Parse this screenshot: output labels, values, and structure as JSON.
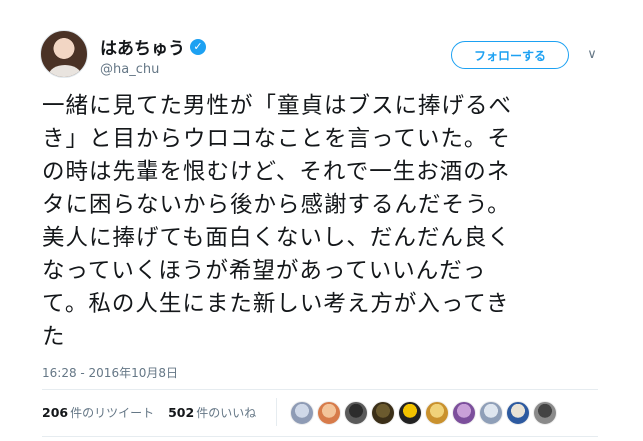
{
  "user": {
    "display_name": "はあちゅう",
    "screen_name": "@ha_chu",
    "verified_icon": "verified-badge-icon"
  },
  "follow_button": {
    "label": "フォローする"
  },
  "caret": {
    "icon": "chevron-down-icon",
    "glyph": "∨"
  },
  "tweet": {
    "lines": [
      "一緒に見てた男性が「童貞はブスに捧げるべ",
      "き」と目からウロコなことを言っていた。そ",
      "の時は先輩を恨むけど、それで一生お酒のネ",
      "タに困らないから後から感謝するんだそう。",
      "美人に捧げても面白くないし、だんだん良く",
      "なっていくほうが希望があっていいんだっ",
      "て。私の人生にまた新しい考え方が入ってき",
      "た"
    ],
    "timestamp": "16:28 - 2016年10月8日"
  },
  "stats": {
    "retweets": {
      "count": "206",
      "label": "件のリツイート"
    },
    "likes": {
      "count": "502",
      "label": "件のいいね"
    }
  },
  "likers": [
    {
      "color_a": "#cfd8e8",
      "color_b": "#8e9bb5"
    },
    {
      "color_a": "#f3c49a",
      "color_b": "#d77b4a"
    },
    {
      "color_a": "#2c2c2c",
      "color_b": "#5a5a5a"
    },
    {
      "color_a": "#6b5a2e",
      "color_b": "#3b2f18"
    },
    {
      "color_a": "#f2c200",
      "color_b": "#222222"
    },
    {
      "color_a": "#f0d27a",
      "color_b": "#c9912e"
    },
    {
      "color_a": "#c9a0d8",
      "color_b": "#7c4f9c"
    },
    {
      "color_a": "#dfe6ef",
      "color_b": "#8f9fb8"
    },
    {
      "color_a": "#e8e2d6",
      "color_b": "#2d5aa0"
    },
    {
      "color_a": "#444444",
      "color_b": "#8a8a8a"
    }
  ]
}
